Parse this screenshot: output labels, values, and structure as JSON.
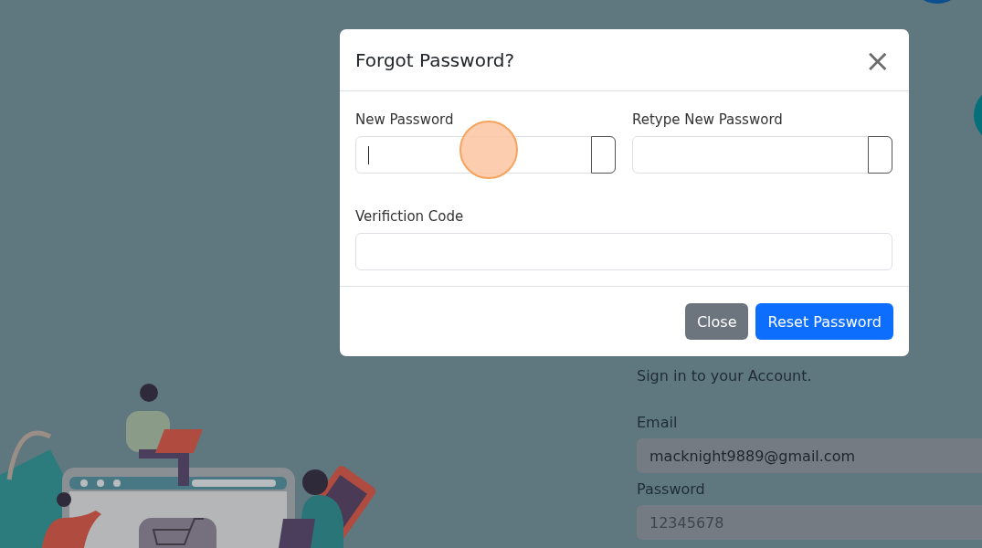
{
  "signin": {
    "subtitle": "Sign in to your Account.",
    "email": {
      "label": "Email",
      "value": "macknight9889@gmail.com"
    },
    "password": {
      "label": "Password",
      "placeholder": "12345678"
    }
  },
  "modal": {
    "title": "Forgot Password?",
    "close_symbol": "×",
    "fields": [
      {
        "kind": "password",
        "label": "New Password",
        "focused": true
      },
      {
        "kind": "password",
        "label": "Retype New Password",
        "focused": false
      },
      {
        "kind": "text",
        "label": "Verifiction Code",
        "focused": false
      }
    ],
    "buttons": [
      {
        "kind": "secondary",
        "label": "Close"
      },
      {
        "kind": "primary",
        "label": "Reset Password"
      }
    ]
  }
}
